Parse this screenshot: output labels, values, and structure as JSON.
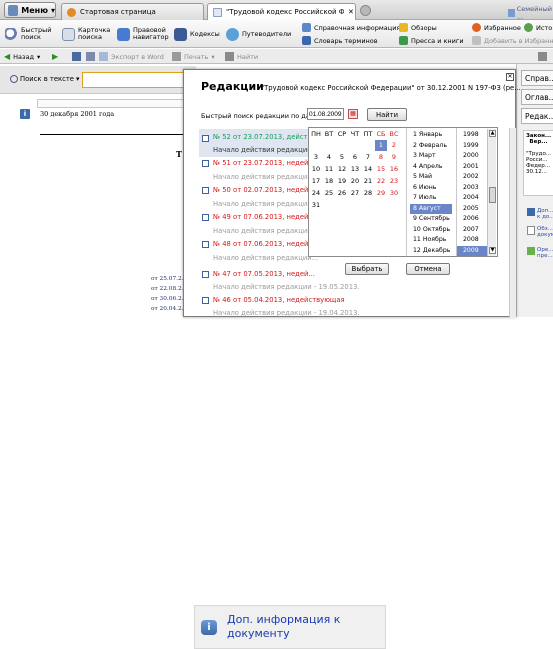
{
  "topbar": {
    "menu": "Меню",
    "tabs": [
      "Стартовая страница",
      "\"Трудовой кодекс Российской Феде...",
      ""
    ],
    "right_label": "Семейный ..."
  },
  "toolbar": {
    "quick_search": "Быстрый поиск",
    "card_search": "Карточка поиска",
    "navigator": "Правовой навигатор",
    "codes": "Кодексы",
    "guides": "Путеводители",
    "reference_info": "Справочная информация",
    "dictionary": "Словарь терминов",
    "reviews": "Обзоры",
    "press": "Пресса и книги",
    "favorites": "Избранное",
    "add_favorites": "Добавить в Избранное",
    "history": "Исто..."
  },
  "navrow": {
    "back": "Назад",
    "export_word": "Экспорт в Word",
    "print": "Печать",
    "find": "Найти"
  },
  "doc": {
    "search_label": "Поиск в тексте",
    "search_value": "",
    "date_line": "30 декабря 2001 года",
    "letter": "Т",
    "history_refs": [
      "от 25.07.2...",
      "от 22.08.2...",
      "от 30.06.2...",
      "от 20.04.2..."
    ]
  },
  "right_panel": {
    "tabs": [
      "Справ...",
      "Оглав...",
      "Редак..."
    ],
    "card_title": "Закон... Вер...",
    "card_text": [
      "\"Трудо...",
      "Росси...",
      "Федер...",
      "30.12..."
    ],
    "links": [
      "Доп... к до...",
      "Обз... докум...",
      "Оре... пре..."
    ]
  },
  "dialog": {
    "title": "Редакции",
    "subtitle": "\"Трудовой кодекс Российской Федерации\" от 30.12.2001 N 197-ФЗ (ре...",
    "date_label": "Быстрый поиск редакции по дате:",
    "date_value": "01.08.2009",
    "find_button": "Найти",
    "editions": [
      {
        "title": "№ 52 от 23.07.2013, дейст...",
        "sub": "Начало действия редакции...",
        "status": "current"
      },
      {
        "title": "№ 51 от 23.07.2013, недей...",
        "sub": "Начало действия редакции...",
        "status": "inactive"
      },
      {
        "title": "№ 50 от 02.07.2013, недей...",
        "sub": "Начало действия редакции...",
        "status": "inactive"
      },
      {
        "title": "№ 49 от 07.06.2013, недей...",
        "sub": "Начало действия редакции...",
        "status": "inactive"
      },
      {
        "title": "№ 48 от 07.06.2013, недей...",
        "sub": "Начало действия редакции...",
        "status": "inactive"
      },
      {
        "title": "№ 47 от 07.05.2013, недей...",
        "sub": "Начало действия редакции - 19.05.2013.",
        "status": "inactive"
      },
      {
        "title": "№ 46 от 05.04.2013, недействующая",
        "sub": "Начало действия редакции - 19.04.2013.",
        "status": "inactive"
      }
    ]
  },
  "calendar": {
    "weekdays": [
      "ПН",
      "ВТ",
      "СР",
      "ЧТ",
      "ПТ",
      "СБ",
      "ВС"
    ],
    "weeks": [
      [
        "",
        "",
        "",
        "",
        "",
        "1",
        "2"
      ],
      [
        "3",
        "4",
        "5",
        "6",
        "7",
        "8",
        "9"
      ],
      [
        "10",
        "11",
        "12",
        "13",
        "14",
        "15",
        "16"
      ],
      [
        "17",
        "18",
        "19",
        "20",
        "21",
        "22",
        "23"
      ],
      [
        "24",
        "25",
        "26",
        "27",
        "28",
        "29",
        "30"
      ],
      [
        "31",
        "",
        "",
        "",
        "",
        "",
        ""
      ]
    ],
    "selected_day": "1",
    "months": [
      "1 Январь",
      "2 Февраль",
      "3 Март",
      "4 Апрель",
      "5 Май",
      "6 Июнь",
      "7 Июль",
      "8 Август",
      "9 Сентябрь",
      "10 Октябрь",
      "11 Ноябрь",
      "12 Декабрь"
    ],
    "selected_month": "8 Август",
    "years": [
      "1998",
      "1999",
      "2000",
      "2001",
      "2002",
      "2003",
      "2004",
      "2005",
      "2006",
      "2007",
      "2008",
      "2009"
    ],
    "selected_year": "2009",
    "choose_button": "Выбрать",
    "cancel_button": "Отмена"
  },
  "info_box": {
    "text": "Доп. информация к документу"
  }
}
